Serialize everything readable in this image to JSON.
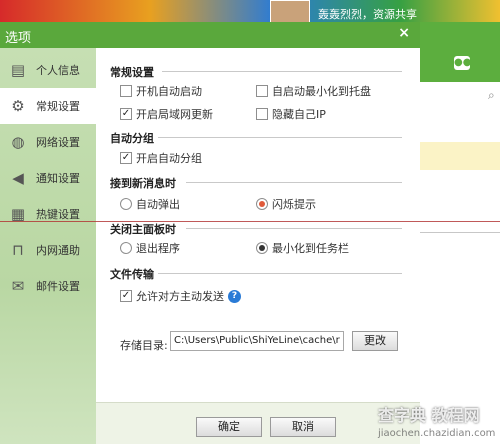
{
  "background": {
    "nickname": "轰轰烈烈，资源共享"
  },
  "dialog": {
    "title": "选项",
    "close": "×"
  },
  "sidebar": {
    "items": [
      {
        "label": "个人信息",
        "icon": "id-card-icon",
        "glyph": "▤"
      },
      {
        "label": "常规设置",
        "icon": "gear-icon",
        "glyph": "⚙"
      },
      {
        "label": "网络设置",
        "icon": "globe-icon",
        "glyph": "◍"
      },
      {
        "label": "通知设置",
        "icon": "speaker-icon",
        "glyph": "◀"
      },
      {
        "label": "热键设置",
        "icon": "keyboard-icon",
        "glyph": "▦"
      },
      {
        "label": "内网通助",
        "icon": "lock-icon",
        "glyph": "⊓"
      },
      {
        "label": "邮件设置",
        "icon": "mail-icon",
        "glyph": "✉"
      }
    ]
  },
  "sections": {
    "general": "常规设置",
    "autogroup": "自动分组",
    "newmsg": "接到新消息时",
    "closepanel": "关闭主面板时",
    "filetransfer": "文件传输"
  },
  "options": {
    "autostart": {
      "label": "开机自动启动",
      "checked": false
    },
    "minimize_tray": {
      "label": "自启动最小化到托盘",
      "checked": false
    },
    "lan_update": {
      "label": "开启局域网更新",
      "checked": true
    },
    "hide_ip": {
      "label": "隐藏自己IP",
      "checked": false
    },
    "auto_group": {
      "label": "开启自动分组",
      "checked": true
    },
    "popup": {
      "label": "自动弹出",
      "selected": false
    },
    "flash": {
      "label": "闪烁提示",
      "selected": true
    },
    "exit_program": {
      "label": "退出程序",
      "selected": false
    },
    "minimize_taskbar": {
      "label": "最小化到任务栏",
      "selected": true
    },
    "allow_send": {
      "label": "允许对方主动发送",
      "checked": true
    }
  },
  "storage": {
    "label": "存储目录:",
    "path": "C:\\Users\\Public\\ShiYeLine\\cache\\r",
    "change_button": "更改"
  },
  "buttons": {
    "ok": "确定",
    "cancel": "取消"
  },
  "watermark": {
    "text": "查字典 教程网",
    "site": "jiaochen.chazidian.com"
  },
  "colors": {
    "titlebar": "#5aa83c",
    "sidebar": "#c6dfb3",
    "flash_radio": "#e05a3a"
  }
}
